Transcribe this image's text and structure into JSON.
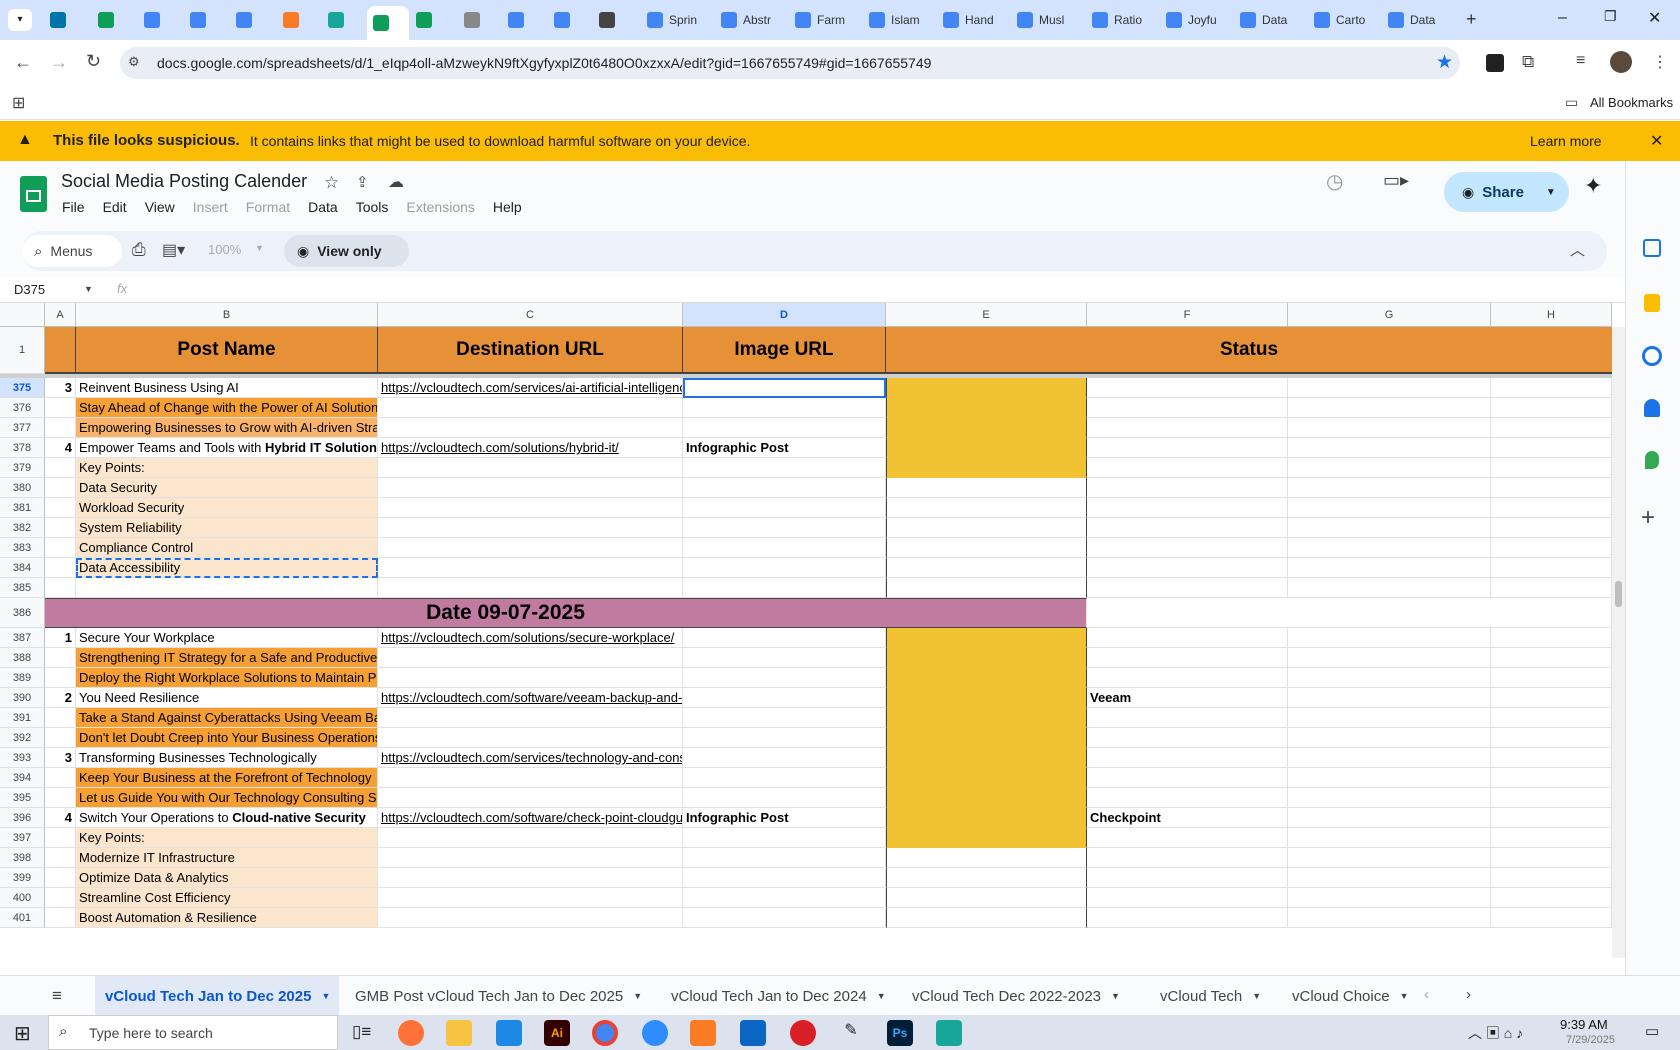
{
  "browser": {
    "tabs": [
      "",
      "",
      "",
      "",
      "",
      "",
      "",
      "",
      "",
      "",
      "",
      "",
      "",
      "",
      "Sprin",
      "Abstr",
      "Farm",
      "Islam",
      "Hand",
      "Musl",
      "Ratio",
      "Joyfu",
      "Data",
      "Carto",
      "Data"
    ],
    "url": "docs.google.com/spreadsheets/d/1_eIqp4oll-aMzweykN9ftXgyfyxplZ0t6480O0xzxxA/edit?gid=1667655749#gid=1667655749",
    "all_bookmarks": "All Bookmarks"
  },
  "warning": {
    "title": "This file looks suspicious.",
    "message": "It contains links that might be used to download harmful software on your device.",
    "learn_more": "Learn more"
  },
  "doc": {
    "title": "Social Media Posting Calender",
    "menus": [
      "File",
      "Edit",
      "View",
      "Insert",
      "Format",
      "Data",
      "Tools",
      "Extensions",
      "Help"
    ],
    "share": "Share"
  },
  "toolbar": {
    "menus_search": "Menus",
    "zoom": "100%",
    "view_only": "View only"
  },
  "formula": {
    "name_box": "D375",
    "fx": "fx"
  },
  "grid": {
    "columns": [
      "A",
      "B",
      "C",
      "D",
      "E",
      "F",
      "G",
      "H"
    ],
    "header_row": {
      "row": "1",
      "post_name": "Post Name",
      "destination_url": "Destination URL",
      "image_url": "Image URL",
      "status": "Status"
    },
    "rows": [
      {
        "row": "375",
        "a": "3",
        "b": "Reinvent Business Using AI",
        "c": "https://vcloudtech.com/services/ai-artificial-intelligence/",
        "d": "",
        "f": ""
      },
      {
        "row": "376",
        "a": "",
        "b": "Stay Ahead of Change with the Power of AI Solutions",
        "c": "",
        "d": "",
        "f": ""
      },
      {
        "row": "377",
        "a": "",
        "b": "Empowering Businesses to Grow with AI-driven Strategies",
        "c": "",
        "d": "",
        "f": ""
      },
      {
        "row": "378",
        "a": "4",
        "b": "Empower Teams and Tools with ",
        "b_bold": "Hybrid IT Solutions",
        "c": "https://vcloudtech.com/solutions/hybrid-it/",
        "d": "Infographic Post",
        "f": ""
      },
      {
        "row": "379",
        "a": "",
        "b": "Key Points:",
        "c": "",
        "d": "",
        "f": ""
      },
      {
        "row": "380",
        "a": "",
        "b": "Data Security",
        "c": "",
        "d": "",
        "f": ""
      },
      {
        "row": "381",
        "a": "",
        "b": "Workload Security",
        "c": "",
        "d": "",
        "f": ""
      },
      {
        "row": "382",
        "a": "",
        "b": "System Reliability",
        "c": "",
        "d": "",
        "f": ""
      },
      {
        "row": "383",
        "a": "",
        "b": "Compliance Control",
        "c": "",
        "d": "",
        "f": ""
      },
      {
        "row": "384",
        "a": "",
        "b": "Data Accessibility",
        "c": "",
        "d": "",
        "f": ""
      },
      {
        "row": "385",
        "a": "",
        "b": "",
        "c": "",
        "d": "",
        "f": ""
      },
      {
        "row": "386",
        "date": "Date 09-07-2025"
      },
      {
        "row": "387",
        "a": "1",
        "b": "Secure Your Workplace",
        "c": "https://vcloudtech.com/solutions/secure-workplace/",
        "d": "",
        "f": ""
      },
      {
        "row": "388",
        "a": "",
        "b": "Strengthening IT Strategy for a Safe and Productive Workplace",
        "c": "",
        "d": "",
        "f": ""
      },
      {
        "row": "389",
        "a": "",
        "b": "Deploy the Right Workplace Solutions to Maintain Productivity",
        "c": "",
        "d": "",
        "f": ""
      },
      {
        "row": "390",
        "a": "2",
        "b": "You Need Resilience",
        "c": "https://vcloudtech.com/software/veeam-backup-and-replication/",
        "d": "",
        "f": "Veeam"
      },
      {
        "row": "391",
        "a": "",
        "b": "Take a Stand Against Cyberattacks Using Veeam Backup",
        "c": "",
        "d": "",
        "f": ""
      },
      {
        "row": "392",
        "a": "",
        "b": "Don't let Doubt Creep into Your Business Operations",
        "c": "",
        "d": "",
        "f": ""
      },
      {
        "row": "393",
        "a": "3",
        "b": "Transforming Businesses Technologically",
        "c": "https://vcloudtech.com/services/technology-and-consulting/",
        "d": "",
        "f": ""
      },
      {
        "row": "394",
        "a": "",
        "b": "Keep Your Business at the Forefront of Technology",
        "c": "",
        "d": "",
        "f": ""
      },
      {
        "row": "395",
        "a": "",
        "b": "Let us Guide You with Our Technology Consulting Services",
        "c": "",
        "d": "",
        "f": ""
      },
      {
        "row": "396",
        "a": "4",
        "b": "Switch Your Operations to ",
        "b_bold": "Cloud-native Security",
        "c": "https://vcloudtech.com/software/check-point-cloudguard/",
        "d": "Infographic Post",
        "f": "Checkpoint"
      },
      {
        "row": "397",
        "a": "",
        "b": "Key Points:",
        "c": "",
        "d": "",
        "f": ""
      },
      {
        "row": "398",
        "a": "",
        "b": "Modernize IT Infrastructure",
        "c": "",
        "d": "",
        "f": ""
      },
      {
        "row": "399",
        "a": "",
        "b": "Optimize Data & Analytics",
        "c": "",
        "d": "",
        "f": ""
      },
      {
        "row": "400",
        "a": "",
        "b": "Streamline Cost Efficiency",
        "c": "",
        "d": "",
        "f": ""
      },
      {
        "row": "401",
        "a": "",
        "b": "Boost Automation & Resilience",
        "c": "",
        "d": "",
        "f": ""
      }
    ]
  },
  "sheet_tabs": [
    "vCloud Tech Jan to Dec 2025",
    "GMB Post vCloud Tech Jan to Dec 2025",
    "vCloud Tech Jan to Dec 2024",
    "vCloud Tech Dec 2022-2023",
    "vCloud Tech",
    "vCloud Choice"
  ],
  "taskbar": {
    "search_placeholder": "Type here to search",
    "time": "9:39 AM",
    "date": "7/29/2025"
  },
  "colors": {
    "header_orange": "#e69138",
    "row_orange": "#f6a033",
    "row_light": "#fce5cd",
    "status_yellow": "#f1c232",
    "date_purple": "#c27ba0",
    "warning_yellow": "#fbbc04"
  }
}
